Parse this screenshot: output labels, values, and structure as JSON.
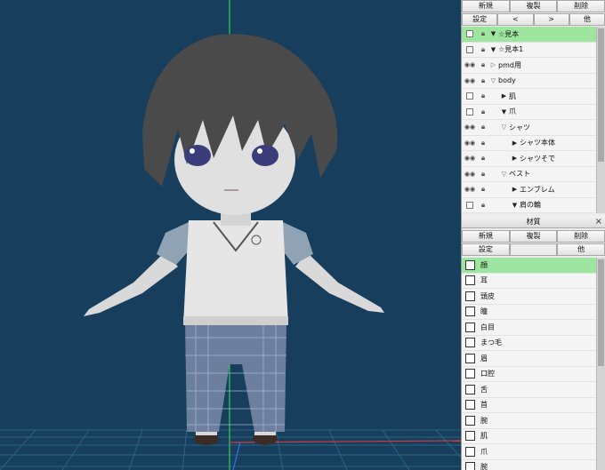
{
  "layer_panel": {
    "buttons_row1": [
      "新規",
      "複製",
      "削除"
    ],
    "buttons_row2": [
      "設定",
      "<",
      ">",
      "他"
    ],
    "layers": [
      {
        "name": "☆見本",
        "visible": false,
        "arrow": "▼",
        "indent": 0,
        "selected": true
      },
      {
        "name": "☆見本1",
        "visible": false,
        "arrow": "▼",
        "indent": 0,
        "selected": false
      },
      {
        "name": "pmd用",
        "visible": true,
        "arrow": "▷",
        "indent": 0,
        "selected": false
      },
      {
        "name": "body",
        "visible": true,
        "arrow": "▽",
        "indent": 0,
        "selected": false
      },
      {
        "name": "肌",
        "visible": false,
        "arrow": "▶",
        "indent": 1,
        "selected": false
      },
      {
        "name": "爪",
        "visible": false,
        "arrow": "▼",
        "indent": 1,
        "selected": false
      },
      {
        "name": "シャツ",
        "visible": true,
        "arrow": "▽",
        "indent": 1,
        "selected": false
      },
      {
        "name": "シャツ本体",
        "visible": true,
        "arrow": "▶",
        "indent": 2,
        "selected": false
      },
      {
        "name": "シャツそで",
        "visible": true,
        "arrow": "▶",
        "indent": 2,
        "selected": false
      },
      {
        "name": "ベスト",
        "visible": true,
        "arrow": "▽",
        "indent": 1,
        "selected": false
      },
      {
        "name": "エンブレム",
        "visible": true,
        "arrow": "▶",
        "indent": 2,
        "selected": false
      },
      {
        "name": "肩の輪",
        "visible": false,
        "arrow": "▼",
        "indent": 2,
        "selected": false
      }
    ]
  },
  "material_panel": {
    "title": "材質",
    "close": "×",
    "buttons_row1": [
      "新規",
      "複製",
      "削除"
    ],
    "buttons_row2": [
      "設定",
      "",
      "他"
    ],
    "materials": [
      "顔",
      "耳",
      "頭皮",
      "瞳",
      "白目",
      "まつ毛",
      "眉",
      "口腔",
      "舌",
      "首",
      "腕",
      "肌",
      "爪",
      "腕"
    ],
    "selected_index": 0
  },
  "colors": {
    "viewport_bg": "#173e5c",
    "selection": "#9ee6a0",
    "axis_green": "#2fd04a",
    "axis_red": "#d83a3a"
  }
}
